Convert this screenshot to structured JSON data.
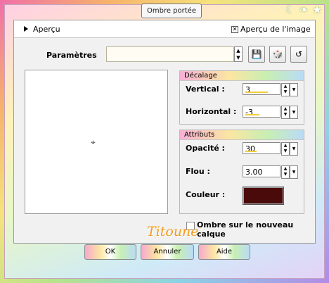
{
  "window": {
    "title": "Ombre portée"
  },
  "preview_section": {
    "label": "Aperçu",
    "image_preview_label": "Aperçu de l'image",
    "image_preview_checked": true
  },
  "presets": {
    "label": "Paramètres",
    "value": ""
  },
  "offset": {
    "title": "Décalage",
    "vertical": {
      "label": "Vertical :",
      "value": "3"
    },
    "horizontal": {
      "label": "Horizontal :",
      "value": "-3"
    }
  },
  "attributes": {
    "title": "Attributs",
    "opacity": {
      "label": "Opacité :",
      "value": "30"
    },
    "blur": {
      "label": "Flou :",
      "value": "3.00"
    },
    "color": {
      "label": "Couleur :",
      "value": "#4a0a0a"
    }
  },
  "shadow_new_layer": {
    "label": "Ombre sur le nouveau calque",
    "checked": false
  },
  "watermark": "Titoune",
  "buttons": {
    "ok": "OK",
    "cancel": "Annuler",
    "help": "Aide"
  }
}
